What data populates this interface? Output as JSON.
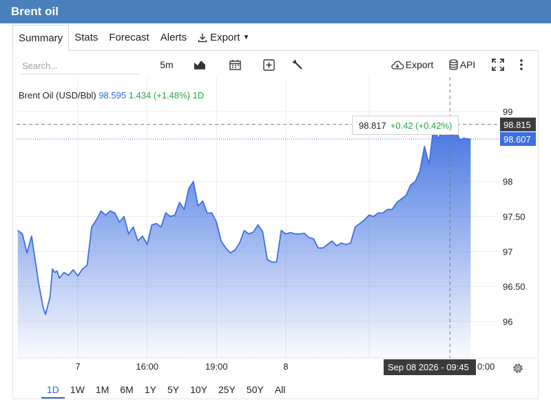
{
  "app": {
    "title": "Brent oil"
  },
  "tabs": [
    {
      "label": "Summary",
      "active": true
    },
    {
      "label": "Stats"
    },
    {
      "label": "Forecast"
    },
    {
      "label": "Alerts"
    },
    {
      "label": "Export",
      "dropdown": true
    }
  ],
  "toolbar": {
    "search_placeholder": "Search...",
    "interval_label": "5m",
    "export_label": "Export",
    "api_label": "API",
    "icons": [
      "chart-type-icon",
      "calendar-icon",
      "add-indicator-icon",
      "wrench-icon",
      "cloud-download-icon",
      "database-icon",
      "fullscreen-icon",
      "more-icon"
    ]
  },
  "info": {
    "name": "Brent Oil (USD/Bbl)",
    "price": "98.595",
    "change": "1.434 (+1.48%)",
    "period": "1D"
  },
  "tooltip": {
    "value": "98.817",
    "change": "+0.42 (+0.42%)"
  },
  "crosshair": {
    "y_label": "98.815",
    "x_label": "Sep 08 2026 - 09:45",
    "x_label_tail": "0:00"
  },
  "last_price_label": "98.607",
  "ranges": [
    {
      "label": "1D",
      "active": true
    },
    {
      "label": "1W"
    },
    {
      "label": "1M"
    },
    {
      "label": "6M"
    },
    {
      "label": "1Y"
    },
    {
      "label": "5Y"
    },
    {
      "label": "10Y"
    },
    {
      "label": "25Y"
    },
    {
      "label": "50Y"
    },
    {
      "label": "All"
    }
  ],
  "colors": {
    "accent": "#2a66d6",
    "header": "#4a7fbd",
    "up": "#22a447",
    "line": "#3d6fe0"
  },
  "chart_data": {
    "type": "area",
    "title": "Brent Oil (USD/Bbl)",
    "xlabel": "",
    "ylabel": "",
    "ylim": [
      95.5,
      99.5
    ],
    "y_ticks": [
      "99",
      "98",
      "97.50",
      "97",
      "96.50",
      "96"
    ],
    "y_tick_values": [
      99,
      98,
      97.5,
      97,
      96.5,
      96
    ],
    "x_ticks": [
      "7",
      "16:00",
      "19:00",
      "8"
    ],
    "x_tick_times": [
      1.0,
      4.0,
      7.0,
      10.0
    ],
    "x_range": [
      -1.6,
      18.2
    ],
    "grid": true,
    "series": [
      {
        "x": [
          -1.6,
          -1.4,
          -1.2,
          -1.0,
          -0.9,
          -0.7,
          -0.5,
          -0.4,
          -0.2,
          -0.1,
          0.0,
          0.1,
          0.2,
          0.4,
          0.6,
          0.8,
          1.0,
          1.2,
          1.4,
          1.6,
          1.8,
          2.0,
          2.2,
          2.4,
          2.6,
          2.8,
          3.0,
          3.2,
          3.4,
          3.6,
          3.8,
          4.0,
          4.2,
          4.4,
          4.6,
          4.8,
          5.0,
          5.2,
          5.4,
          5.6,
          5.8,
          6.0,
          6.2,
          6.4,
          6.6,
          6.8,
          7.0,
          7.2,
          7.4,
          7.6,
          7.8,
          8.0,
          8.2,
          8.4,
          8.6,
          8.8,
          9.0,
          9.2,
          9.4,
          9.6,
          9.8,
          10.0,
          10.2,
          10.4,
          10.6,
          10.8,
          11.0,
          11.2,
          11.4,
          11.6,
          11.8,
          12.0,
          12.2,
          12.4,
          12.6,
          12.8,
          13.0,
          13.2,
          13.4,
          13.6,
          13.8,
          14.0,
          14.2,
          14.4,
          14.6,
          14.8,
          15.0,
          15.2,
          15.4,
          15.6,
          15.8,
          16.0,
          16.2,
          16.4,
          16.6,
          16.8,
          17.0,
          17.2,
          17.3,
          17.4,
          17.5,
          17.6,
          17.7,
          17.8,
          18.0
        ],
        "y": [
          97.3,
          97.25,
          96.98,
          97.22,
          97.0,
          96.55,
          96.2,
          96.1,
          96.35,
          96.75,
          96.7,
          96.72,
          96.62,
          96.7,
          96.66,
          96.74,
          96.65,
          96.75,
          96.8,
          97.35,
          97.45,
          97.58,
          97.52,
          97.58,
          97.55,
          97.42,
          97.5,
          97.25,
          97.35,
          97.15,
          97.22,
          97.1,
          97.38,
          97.4,
          97.35,
          97.55,
          97.5,
          97.52,
          97.7,
          97.6,
          97.9,
          98.0,
          97.65,
          97.72,
          97.55,
          97.55,
          97.42,
          97.15,
          97.05,
          96.98,
          97.02,
          97.12,
          97.3,
          97.25,
          97.28,
          97.38,
          97.28,
          96.88,
          96.85,
          96.85,
          97.3,
          97.25,
          97.27,
          97.25,
          97.25,
          97.26,
          97.2,
          97.18,
          97.05,
          97.05,
          97.1,
          97.15,
          97.08,
          97.12,
          97.1,
          97.12,
          97.35,
          97.4,
          97.45,
          97.52,
          97.5,
          97.55,
          97.55,
          97.6,
          97.6,
          97.7,
          97.75,
          97.8,
          97.95,
          98.0,
          98.15,
          98.5,
          98.25,
          98.8,
          98.6,
          98.8,
          98.7,
          98.65,
          98.75,
          98.7,
          98.61,
          98.6,
          98.62,
          98.61,
          98.607
        ]
      }
    ],
    "crosshair_value": 98.815,
    "crosshair_time": 17.1,
    "last_value": 98.607
  }
}
